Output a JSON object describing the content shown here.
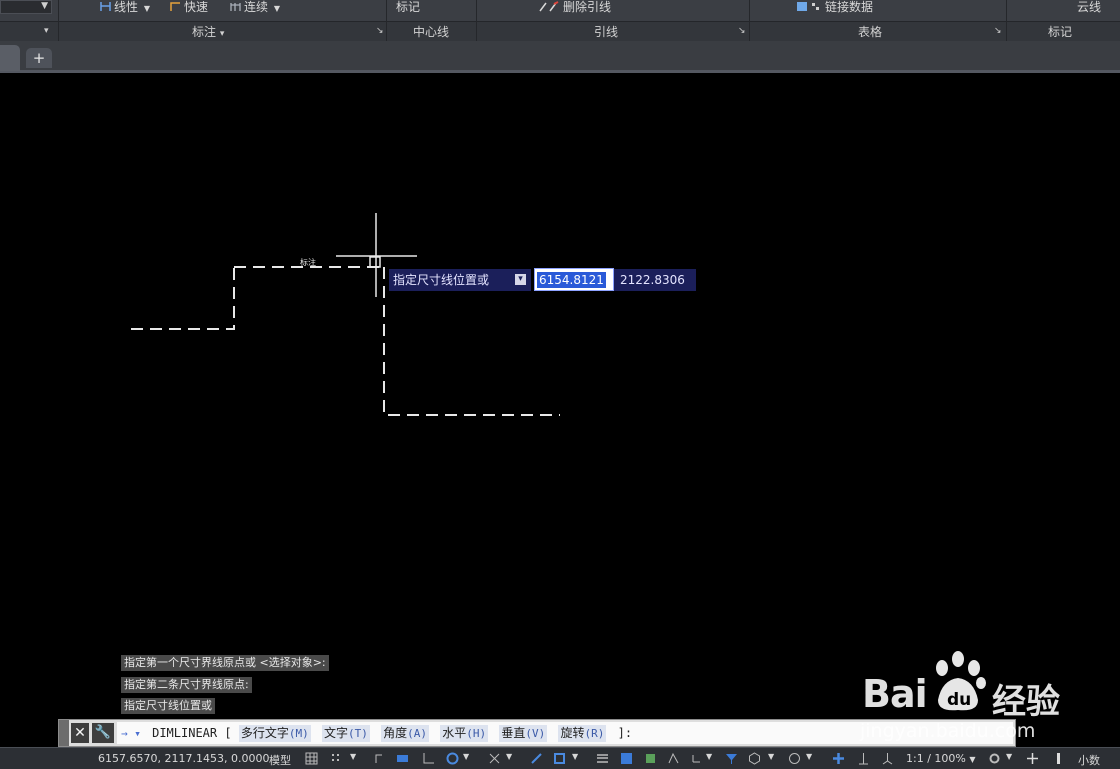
{
  "ribbon": {
    "row1": {
      "linear_label": "线性",
      "quick_label": "快速",
      "continue_label": "连续",
      "markup_label": "标记",
      "remove_leader_label": "删除引线",
      "link_data_label": "链接数据",
      "revcloud_label": "云线"
    },
    "groups": {
      "dimension": "标注",
      "centerline": "中心线",
      "leader": "引线",
      "table": "表格",
      "markup": "标记"
    }
  },
  "tabs": {
    "new_tab_symbol": "+"
  },
  "canvas": {
    "dimension_text": "标注",
    "dynamic_input": {
      "prompt": "指定尺寸线位置或",
      "x_value": "6154.8121",
      "y_value": "2122.8306"
    }
  },
  "command_history": [
    "指定第一个尺寸界线原点或 <选择对象>:",
    "指定第二条尺寸界线原点:",
    "指定尺寸线位置或"
  ],
  "command_line": {
    "prefix": "→ ▾",
    "command": "DIMLINEAR",
    "open_bracket": "[",
    "options": [
      {
        "label": "多行文字",
        "key": "(M)"
      },
      {
        "label": "文字",
        "key": "(T)"
      },
      {
        "label": "角度",
        "key": "(A)"
      },
      {
        "label": "水平",
        "key": "(H)"
      },
      {
        "label": "垂直",
        "key": "(V)"
      },
      {
        "label": "旋转",
        "key": "(R)"
      }
    ],
    "close": "]:"
  },
  "status_bar": {
    "coordinates": "6157.6570, 2117.1453, 0.0000",
    "model_label": "模型",
    "annotation_scale": "1:1 / 100%",
    "units": "小数"
  },
  "watermark": {
    "brand": "Bai",
    "brand2": "du",
    "cn": "经验",
    "url": "jingyan.baidu.com"
  },
  "colors": {
    "canvas_bg": "#000000",
    "ribbon_bg": "#3b3e44",
    "dyn_input_bg": "#1b1f5a",
    "input_selection": "#2a5ad8"
  }
}
